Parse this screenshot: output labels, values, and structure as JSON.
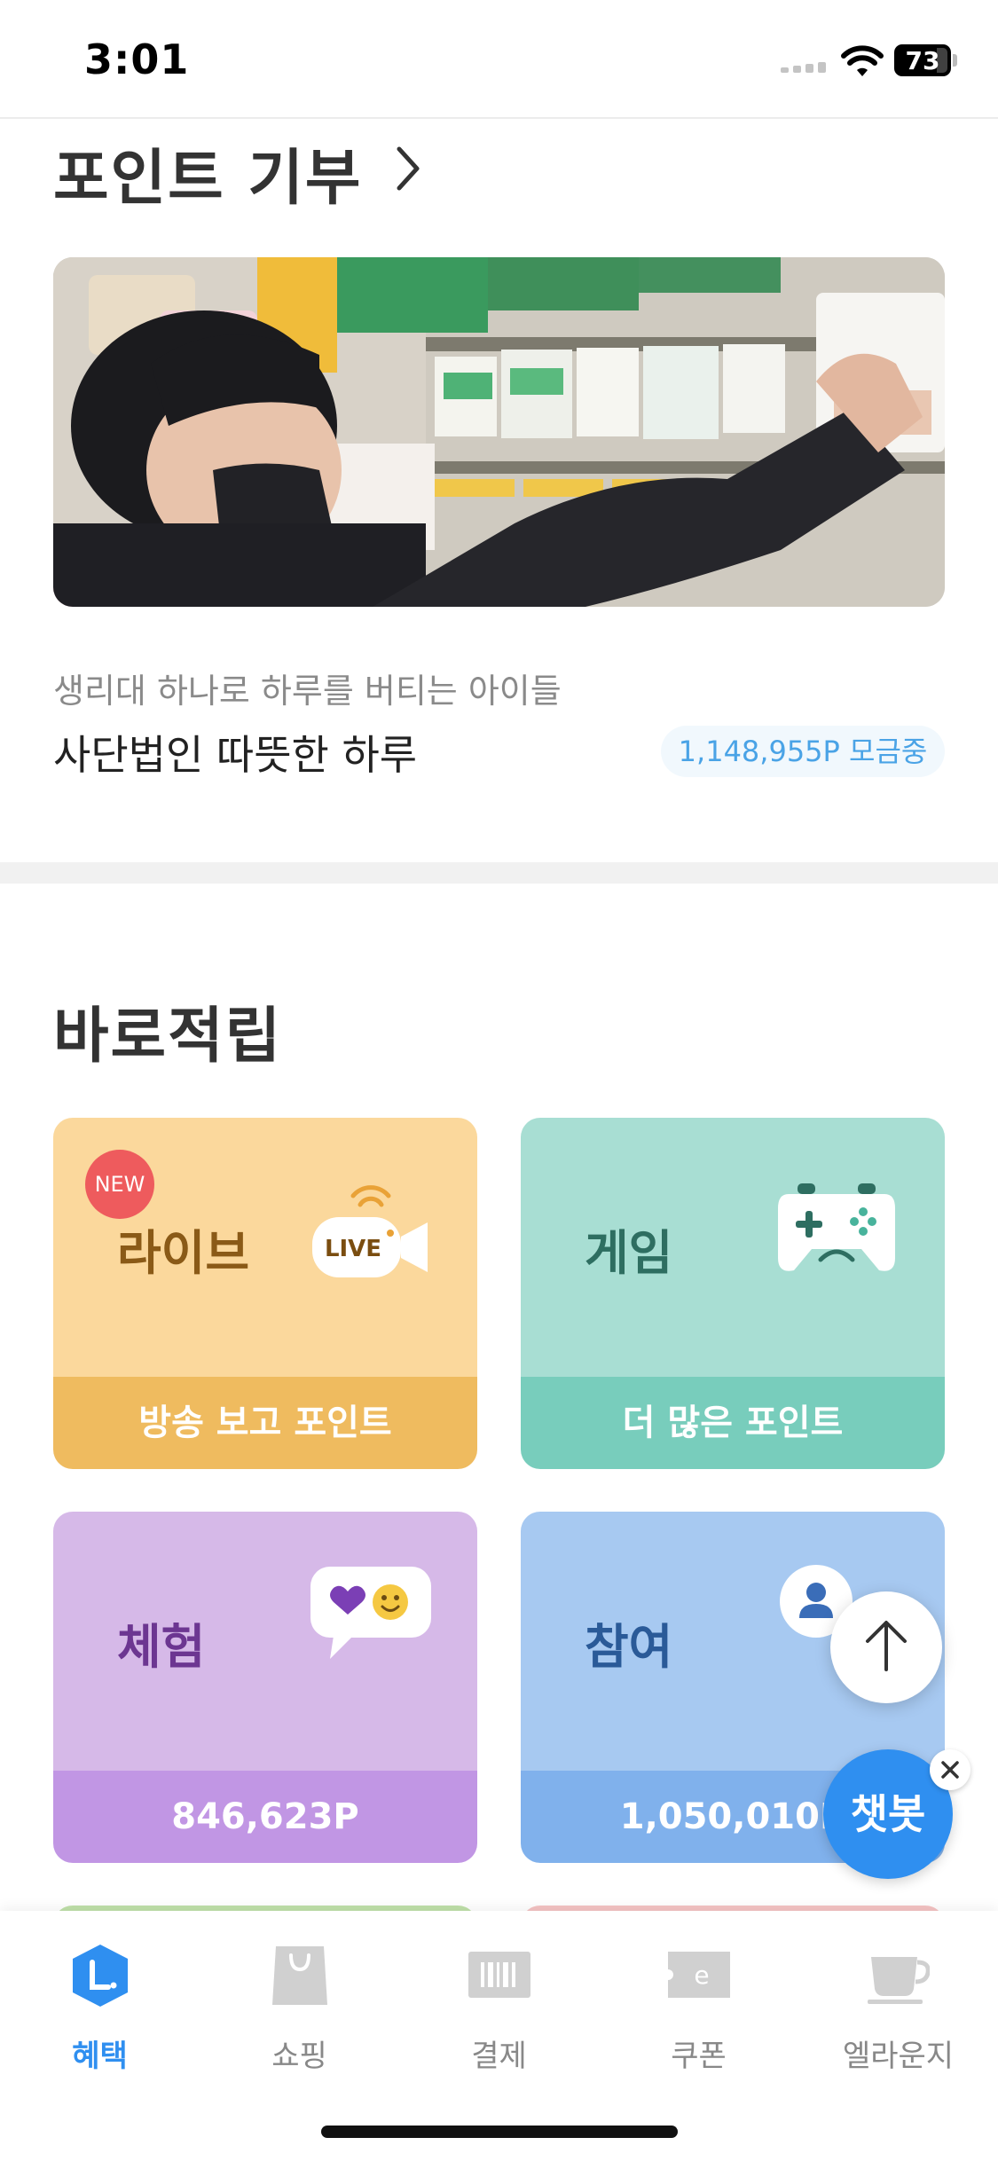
{
  "status_bar": {
    "time": "3:01",
    "battery": "73"
  },
  "donation": {
    "title": "포인트 기부",
    "campaign": {
      "subtitle": "생리대 하나로 하루를 버티는 아이들",
      "organization": "사단법인 따뜻한 하루",
      "points": "1,148,955P 모금중"
    }
  },
  "instant": {
    "title": "바로적립",
    "cards": [
      {
        "label": "라이브",
        "badge": "NEW",
        "bottom": "방송 보고 포인트",
        "icon": "live-camera-icon",
        "icon_text": "LIVE"
      },
      {
        "label": "게임",
        "bottom": "더 많은 포인트",
        "icon": "gamepad-icon"
      },
      {
        "label": "체험",
        "bottom": "846,623P",
        "icon": "chat-bubble-heart-icon"
      },
      {
        "label": "참여",
        "bottom": "1,050,010P",
        "icon": "person-icon"
      }
    ]
  },
  "floating": {
    "chatbot": "챗봇"
  },
  "tabbar": {
    "items": [
      {
        "label": "혜택",
        "icon": "benefit-icon",
        "active": true
      },
      {
        "label": "쇼핑",
        "icon": "shopping-bag-icon",
        "active": false
      },
      {
        "label": "결제",
        "icon": "barcode-icon",
        "active": false
      },
      {
        "label": "쿠폰",
        "icon": "coupon-icon",
        "active": false
      },
      {
        "label": "엘라운지",
        "icon": "coffee-cup-icon",
        "active": false
      }
    ]
  },
  "colors": {
    "accent": "#2f8ff0",
    "points_text": "#4aa3e6",
    "new_badge": "#ee5b5d",
    "live_card": "#fbd89c",
    "game_card": "#a8ded3",
    "experience_card": "#d6b9e8",
    "participate_card": "#a7c9f1"
  }
}
